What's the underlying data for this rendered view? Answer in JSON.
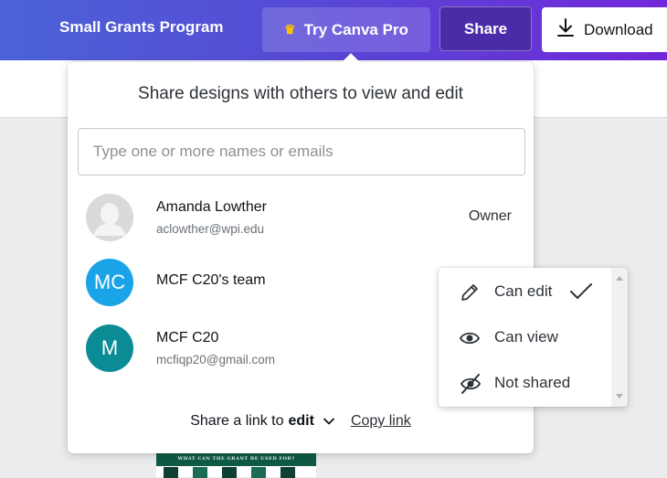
{
  "topbar": {
    "title": "Small Grants Program",
    "pro_label": "Try Canva Pro",
    "share_label": "Share",
    "download_label": "Download",
    "pro_icon": "crown-icon",
    "download_icon": "download-icon",
    "gradient": [
      "#4b63d6",
      "#7228d8"
    ]
  },
  "share_panel": {
    "title": "Share designs with others to view and edit",
    "input_placeholder": "Type one or more names or emails",
    "input_value": "",
    "members": [
      {
        "name": "Amanda Lowther",
        "email": "aclowther@wpi.edu",
        "role": "Owner",
        "avatar": "user-silhouette-icon",
        "avatar_color": "#d6d8da"
      },
      {
        "name": "MCF C20's team",
        "initials": "MC",
        "avatar_color": "#19a4e8"
      },
      {
        "name": "MCF C20",
        "email": "mcfiqp20@gmail.com",
        "initials": "M",
        "avatar_color": "#0b8c94"
      }
    ],
    "footer": {
      "link_prefix": "Share a link to",
      "link_mode": "edit",
      "copy_link": "Copy link"
    }
  },
  "permission_menu": {
    "options": [
      {
        "label": "Can edit",
        "icon": "pencil-icon",
        "selected": true
      },
      {
        "label": "Can view",
        "icon": "eye-icon",
        "selected": false
      },
      {
        "label": "Not shared",
        "icon": "eye-slash-icon",
        "selected": false
      }
    ]
  },
  "design_thumbnail": {
    "band_text": "WHAT CAN THE GRANT BE USED FOR?"
  }
}
